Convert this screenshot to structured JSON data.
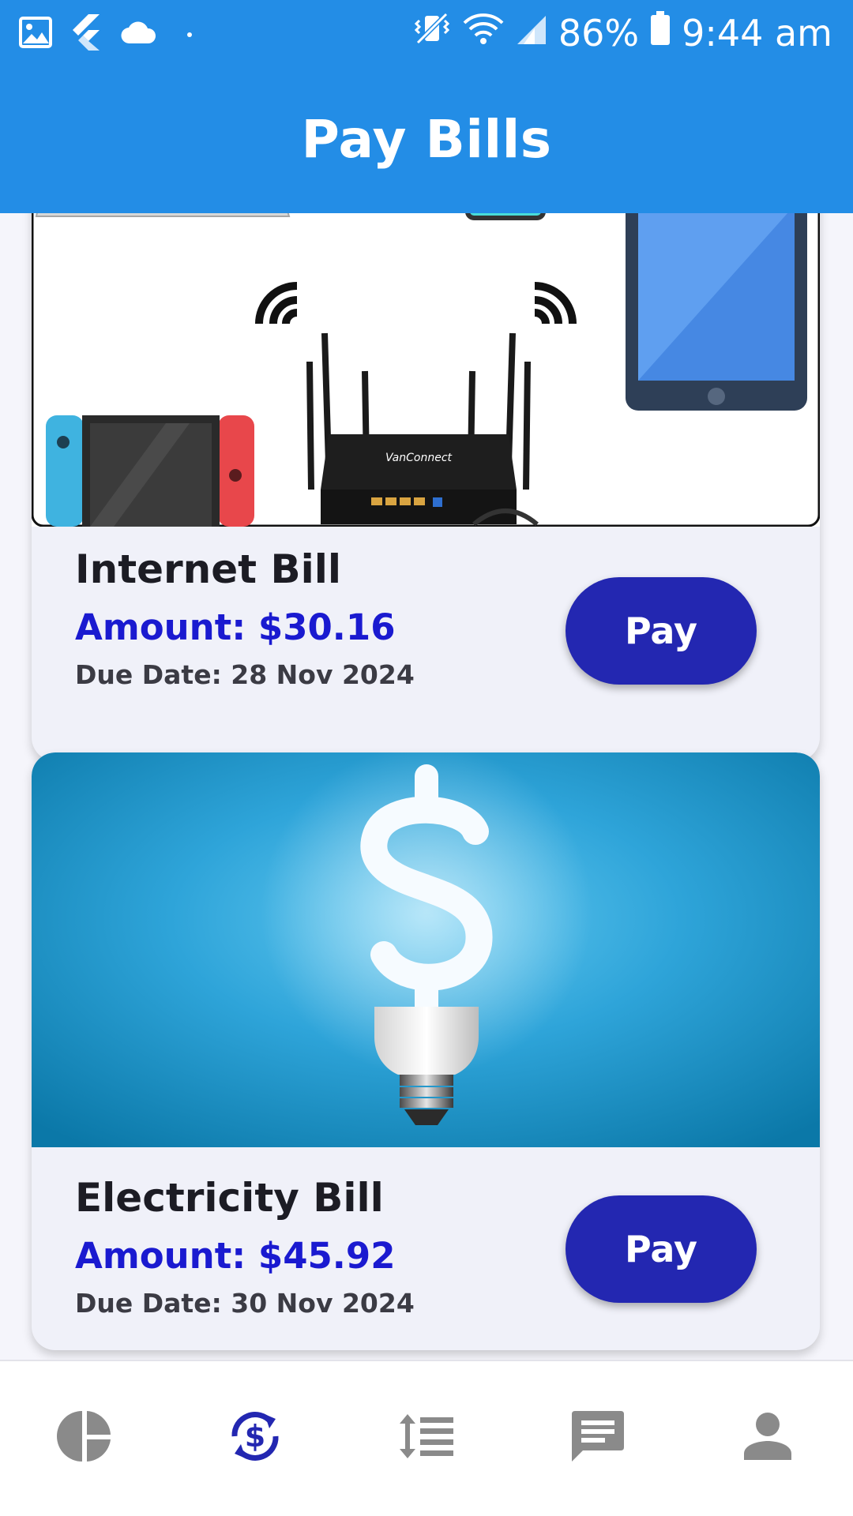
{
  "status_bar": {
    "battery": "86%",
    "time": "9:44 am"
  },
  "header": {
    "title": "Pay Bills"
  },
  "bills": [
    {
      "title": "Internet Bill",
      "amount": "Amount: $30.16",
      "due": "Due Date: 28 Nov 2024",
      "pay_label": "Pay",
      "image_brand": "VanConnect"
    },
    {
      "title": "Electricity Bill",
      "amount": "Amount: $45.92",
      "due": "Due Date: 30 Nov 2024",
      "pay_label": "Pay"
    }
  ],
  "bottom_nav": {
    "items": [
      {
        "icon": "pie-chart-icon",
        "active": false
      },
      {
        "icon": "currency-exchange-icon",
        "active": true
      },
      {
        "icon": "line-height-icon",
        "active": false
      },
      {
        "icon": "chat-icon",
        "active": false
      },
      {
        "icon": "person-icon",
        "active": false
      }
    ]
  },
  "colors": {
    "primary": "#238de6",
    "pay_button": "#2327b1",
    "amount_text": "#1a1ad0",
    "card_bg": "#f0f1f9",
    "nav_active": "#2327b1",
    "nav_inactive": "#8a8a8a"
  }
}
